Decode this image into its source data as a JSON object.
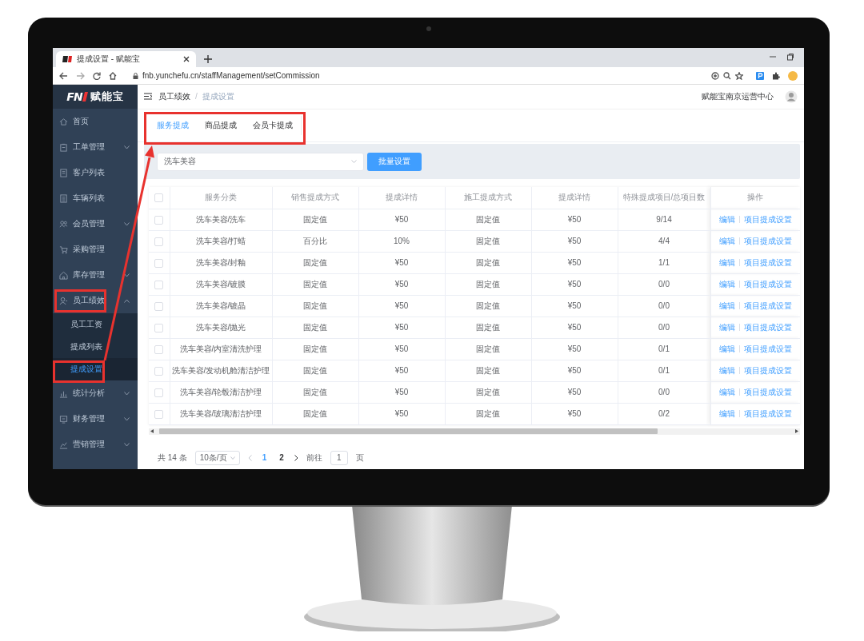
{
  "browser": {
    "tab_title": "提成设置 - 赋能宝",
    "url": "fnb.yunchefu.cn/staffManagement/setCommission"
  },
  "sidebar": {
    "logo_mark": "FN",
    "logo_text": "赋能宝",
    "items": [
      {
        "label": "首页",
        "expandable": false
      },
      {
        "label": "工单管理",
        "expandable": true,
        "expanded": false
      },
      {
        "label": "客户列表",
        "expandable": false
      },
      {
        "label": "车辆列表",
        "expandable": false
      },
      {
        "label": "会员管理",
        "expandable": true,
        "expanded": false
      },
      {
        "label": "采购管理",
        "expandable": false
      },
      {
        "label": "库存管理",
        "expandable": true,
        "expanded": false
      },
      {
        "label": "员工绩效",
        "expandable": true,
        "expanded": true,
        "children": [
          {
            "label": "员工工资",
            "selected": false
          },
          {
            "label": "提成列表",
            "selected": false
          },
          {
            "label": "提成设置",
            "selected": true
          }
        ]
      },
      {
        "label": "统计分析",
        "expandable": true,
        "expanded": false
      },
      {
        "label": "财务管理",
        "expandable": true,
        "expanded": false
      },
      {
        "label": "营销管理",
        "expandable": true,
        "expanded": false
      }
    ]
  },
  "header": {
    "breadcrumb": [
      {
        "label": "员工绩效",
        "current": false
      },
      {
        "label": "提成设置",
        "current": true
      }
    ],
    "breadcrumb_separator": "/",
    "org_name": "赋能宝南京运营中心"
  },
  "tabs": [
    {
      "label": "服务提成",
      "selected": true
    },
    {
      "label": "商品提成",
      "selected": false
    },
    {
      "label": "会员卡提成",
      "selected": false
    }
  ],
  "filter": {
    "category": "洗车美容",
    "button": "批量设置"
  },
  "table": {
    "header_checked": false,
    "columns": [
      "服务分类",
      "销售提成方式",
      "提成详情",
      "施工提成方式",
      "提成详情",
      "特殊提成项目/总项目数",
      "操作"
    ],
    "rows": [
      {
        "checked": false,
        "cells": [
          "洗车美容/洗车",
          "固定值",
          "¥50",
          "固定值",
          "¥50",
          "9/14"
        ],
        "actions": [
          "编辑",
          "项目提成设置"
        ]
      },
      {
        "checked": false,
        "cells": [
          "洗车美容/打蜡",
          "百分比",
          "10%",
          "固定值",
          "¥50",
          "4/4"
        ],
        "actions": [
          "编辑",
          "项目提成设置"
        ]
      },
      {
        "checked": false,
        "cells": [
          "洗车美容/封釉",
          "固定值",
          "¥50",
          "固定值",
          "¥50",
          "1/1"
        ],
        "actions": [
          "编辑",
          "项目提成设置"
        ]
      },
      {
        "checked": false,
        "cells": [
          "洗车美容/镀膜",
          "固定值",
          "¥50",
          "固定值",
          "¥50",
          "0/0"
        ],
        "actions": [
          "编辑",
          "项目提成设置"
        ]
      },
      {
        "checked": false,
        "cells": [
          "洗车美容/镀晶",
          "固定值",
          "¥50",
          "固定值",
          "¥50",
          "0/0"
        ],
        "actions": [
          "编辑",
          "项目提成设置"
        ]
      },
      {
        "checked": false,
        "cells": [
          "洗车美容/抛光",
          "固定值",
          "¥50",
          "固定值",
          "¥50",
          "0/0"
        ],
        "actions": [
          "编辑",
          "项目提成设置"
        ]
      },
      {
        "checked": false,
        "cells": [
          "洗车美容/内室清洗护理",
          "固定值",
          "¥50",
          "固定值",
          "¥50",
          "0/1"
        ],
        "actions": [
          "编辑",
          "项目提成设置"
        ]
      },
      {
        "checked": false,
        "cells": [
          "洗车美容/发动机舱清洁护理",
          "固定值",
          "¥50",
          "固定值",
          "¥50",
          "0/1"
        ],
        "actions": [
          "编辑",
          "项目提成设置"
        ]
      },
      {
        "checked": false,
        "cells": [
          "洗车美容/轮毂清洁护理",
          "固定值",
          "¥50",
          "固定值",
          "¥50",
          "0/0"
        ],
        "actions": [
          "编辑",
          "项目提成设置"
        ]
      },
      {
        "checked": false,
        "cells": [
          "洗车美容/玻璃清洁护理",
          "固定值",
          "¥50",
          "固定值",
          "¥50",
          "0/2"
        ],
        "actions": [
          "编辑",
          "项目提成设置"
        ]
      }
    ]
  },
  "pagination": {
    "total": "共 14 条",
    "page_size": "10条/页",
    "pages": [
      {
        "label": "1",
        "selected": true
      },
      {
        "label": "2",
        "selected": false
      }
    ],
    "goto_label": "前往",
    "goto_value": "1",
    "goto_suffix": "页"
  }
}
